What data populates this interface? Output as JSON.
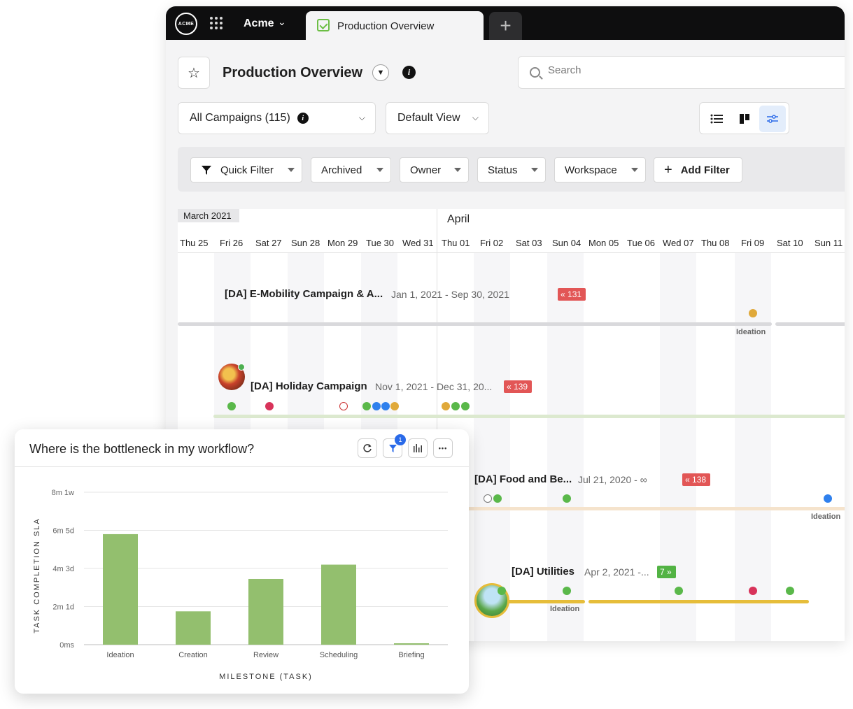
{
  "topbar": {
    "logo_text": "ACME",
    "org": "Acme",
    "tab_label": "Production Overview",
    "add_tab": "+"
  },
  "header": {
    "title": "Production Overview",
    "search_placeholder": "Search"
  },
  "toolbar": {
    "campaigns": "All Campaigns (115)",
    "view": "Default View"
  },
  "filters": {
    "quick": "Quick Filter",
    "archived": "Archived",
    "owner": "Owner",
    "status": "Status",
    "workspace": "Workspace",
    "add": "Add Filter"
  },
  "timeline": {
    "months": {
      "march": "March 2021",
      "april": "April"
    },
    "days": [
      "Thu 25",
      "Fri 26",
      "Sat 27",
      "Sun 28",
      "Mon 29",
      "Tue 30",
      "Wed 31",
      "Thu 01",
      "Fri 02",
      "Sat 03",
      "Sun 04",
      "Mon 05",
      "Tue 06",
      "Wed 07",
      "Thu 08",
      "Fri 09",
      "Sat 10",
      "Sun 11"
    ],
    "campaigns": [
      {
        "title": "[DA] E-Mobility Campaign & A...",
        "dates": "Jan 1, 2021 - Sep 30, 2021",
        "flag": "131",
        "milestone": "Ideation"
      },
      {
        "title": "[DA] Holiday Campaign",
        "dates": "Nov 1, 2021 - Dec 31, 20...",
        "flag": "139"
      },
      {
        "title": "[DA] Food and Be...",
        "dates": "Jul 21, 2020 - ∞",
        "flag": "138",
        "milestone": "Ideation"
      },
      {
        "title": "[DA] Utilities",
        "dates": "Apr 2, 2021 -...",
        "flag": "7",
        "milestone": "Ideation"
      }
    ]
  },
  "card": {
    "title": "Where is the bottleneck in my workflow?",
    "filter_badge": "1",
    "more": "•••"
  },
  "colors": {
    "accent": "#2a6ae9",
    "bar": "#93bf6e",
    "flag_red": "#e25656",
    "flag_green": "#52b344"
  },
  "chart_data": {
    "type": "bar",
    "title": "",
    "xlabel": "MILESTONE (TASK)",
    "ylabel": "TASK COMPLETION SLA",
    "categories": [
      "Ideation",
      "Creation",
      "Review",
      "Scheduling",
      "Briefing"
    ],
    "values": [
      5.8,
      1.75,
      3.45,
      4.2,
      0.05
    ],
    "y_ticks": [
      0,
      2,
      4,
      6,
      8
    ],
    "y_tick_labels": [
      "0ms",
      "2m 1d",
      "4m 3d",
      "6m 5d",
      "8m 1w"
    ],
    "ylim": [
      0,
      8
    ],
    "grid": true
  }
}
